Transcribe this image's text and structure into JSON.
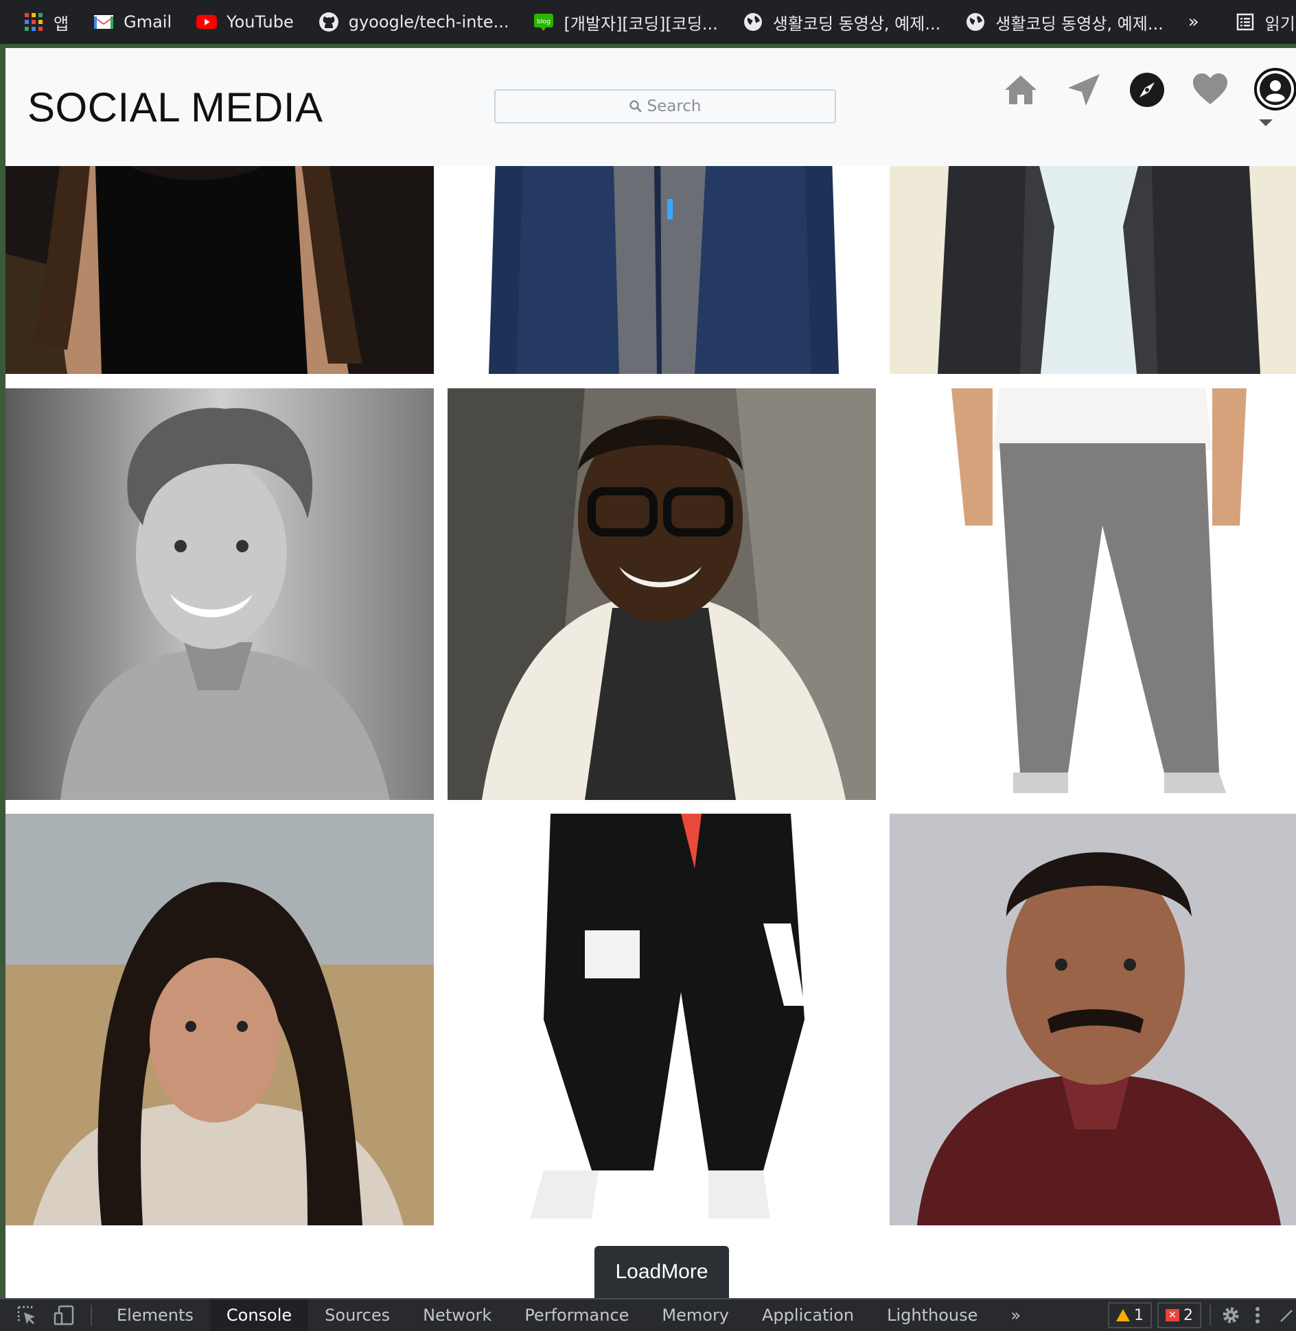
{
  "bookmarks": [
    {
      "label": "앱",
      "icon": "apps-grid-icon"
    },
    {
      "label": "Gmail",
      "icon": "gmail-icon"
    },
    {
      "label": "YouTube",
      "icon": "youtube-icon"
    },
    {
      "label": "gyoogle/tech-inte...",
      "icon": "github-icon"
    },
    {
      "label": "[개발자][코딩][코딩...",
      "icon": "blog-icon"
    },
    {
      "label": "생활코딩 동영상, 예제...",
      "icon": "globe-icon"
    },
    {
      "label": "생활코딩 동영상, 예제...",
      "icon": "globe-icon"
    }
  ],
  "bookmarks_more": "»",
  "reading_list": "읽기 목록",
  "header": {
    "brand": "SOCIAL MEDIA",
    "search_placeholder": "Search"
  },
  "nav_icons": [
    "home-icon",
    "send-icon",
    "explore-icon",
    "heart-icon",
    "profile-icon"
  ],
  "grid": {
    "rows": 3,
    "columns": 3,
    "tiles": [
      {
        "subject": "woman in black top"
      },
      {
        "subject": "navy zip jacket"
      },
      {
        "subject": "dark blazer with white shirt"
      },
      {
        "subject": "man with curly hair"
      },
      {
        "subject": "man with glasses in white jacket"
      },
      {
        "subject": "grey jogger pants"
      },
      {
        "subject": "woman with long dark hair"
      },
      {
        "subject": "black cargo pants"
      },
      {
        "subject": "man in maroon shirt"
      }
    ]
  },
  "load_more": "LoadMore",
  "devtools": {
    "tabs": [
      "Elements",
      "Console",
      "Sources",
      "Network",
      "Performance",
      "Memory",
      "Application",
      "Lighthouse"
    ],
    "active_tab": "Console",
    "more": "»",
    "warnings": "1",
    "errors": "2"
  }
}
